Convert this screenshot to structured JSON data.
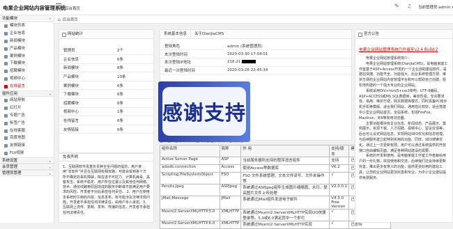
{
  "header": {
    "brand": "电果企业网站内容管理系统",
    "site_home": "后台首页",
    "user": "当前管理员:admin"
  },
  "sidebar": [
    {
      "section": "功能模块",
      "items": [
        {
          "label": "模块列表"
        },
        {
          "label": "企业信息"
        },
        {
          "label": "新闻模块"
        },
        {
          "label": "产品模块"
        },
        {
          "label": "案例模块"
        },
        {
          "label": "下载模块"
        },
        {
          "label": "招聘模块"
        },
        {
          "label": "视频中心"
        },
        {
          "label": "在线留言",
          "active": true
        }
      ]
    },
    {
      "section": "插件应用",
      "items": [
        {
          "label": "网站导航"
        },
        {
          "label": "幻灯片"
        },
        {
          "label": "专题广告"
        },
        {
          "label": "标签广告"
        },
        {
          "label": "在线客服"
        },
        {
          "label": "百度地图"
        },
        {
          "label": "友情链接"
        },
        {
          "label": "FLV视频"
        }
      ]
    },
    {
      "section": "系统设置",
      "items": []
    },
    {
      "section": "会员管理",
      "items": []
    },
    {
      "section": "管理员管理",
      "items": []
    }
  ],
  "tabbar": {
    "home": "后台首页"
  },
  "stats": {
    "title": "网站统计",
    "rows": [
      {
        "label": "管理员",
        "value": "2个"
      },
      {
        "label": "企业信息",
        "value": "6条"
      },
      {
        "label": "新闻模块",
        "value": "8条"
      },
      {
        "label": "产品模块",
        "value": "10条"
      },
      {
        "label": "案例模块",
        "value": "6条"
      },
      {
        "label": "下载模块",
        "value": "6条"
      },
      {
        "label": "招聘模块",
        "value": "6条"
      },
      {
        "label": "视频中心",
        "value": "1条"
      },
      {
        "label": "在线留言",
        "value": "6条"
      },
      {
        "label": "友情链接",
        "value": "6条"
      }
    ]
  },
  "sysinfo": {
    "tabs": [
      "系统基本信息",
      "关于DianJiaCMS"
    ],
    "rows": [
      {
        "label": "登陆角色",
        "value": "admin (系统管理员)"
      },
      {
        "label": "本次登陆时间",
        "value": "2020-03-30 17:04:01"
      },
      {
        "label": "本次登陆IP地址",
        "value": "218.21."
      },
      {
        "label": "最近一次登陆时间",
        "value": "2020-03-26 22:45:34"
      }
    ]
  },
  "overlay": {
    "text": "感谢支持"
  },
  "components": {
    "title": "基本组件检测（如果下面几项都显示会同时进行预览）",
    "headers": [
      "组件名称",
      "简称",
      "作 用",
      "支持/版本",
      "建议"
    ],
    "rows": [
      {
        "name": "Active Server Page",
        "short": "ASP",
        "use": "当前服务器所支持的程序语言组件",
        "ver": "支持",
        "advice": "已支持"
      },
      {
        "name": "adodb.connection",
        "short": "Access",
        "use": "使用Access等数据库",
        "ver": "V6.2",
        "advice": "已支持"
      },
      {
        "name": "Scripting.FileSystemObject",
        "short": "FSO",
        "use": "FSO 文件系统管理、文本文件读写、文件夹操作等",
        "ver": "√",
        "advice": "已支持"
      },
      {
        "name": "Persits.Jpeg",
        "short": "ASPJpeg",
        "use": "系统通过ASPJpeg组件生成图片缩略图，水印，提高图片文件上传处理",
        "ver": "V2.0.0.1",
        "advice": "已支持"
      },
      {
        "name": "JMail.Message",
        "short": "JMail",
        "use": "系统通过JMail组件发送电子邮件",
        "ver": "V4.3.0 Free Version",
        "advice": "已支持"
      },
      {
        "name": "Msxml2.ServerXMLHTTP.5.0",
        "short": "XMLHTTP",
        "use": "系统通过Msxml2.ServerXMLHTTP实现QQ快捷登录等。5.0或6.0满足其中一个即可",
        "ver": "√",
        "advice": "已支持"
      },
      {
        "name": "Msxml2.ServerXMLHTTP.6.0",
        "short": "XMLHTTP",
        "use": "系统通过Msxml2.ServerXMLHTTP实现",
        "ver": "√",
        "advice": "已支持"
      }
    ]
  },
  "disclaimer": {
    "title": "免责声明",
    "body": "1、互联网软件看重负责种全全问题的提前，用户使用“本软件”并且在互联网有相安路，可能会受到各个方所不确定的事机障碍，除在进不可抗力、计算机病毒、黑客攻击、系统不稳定、用户所在位置以及其他任何网络、技术、通信线路等原因造成的服务中断或不能满足用户要求的风险，开发者不对此承担任何责任。 2、用户在使用本系统时引用的内容、信息发布，有可能涉及法律法规问题，开发者不承担任何法律责任，由用户本人承担。3、互联网上流传、复制、发布、传播的信息，开发者不承担任何法律责任。"
  },
  "notice": {
    "title": "官方公告",
    "link": "电果企业网站管理系统已升级至v2.4 Build 2",
    "paragraphs": [
      "电果企业网站管理系统简介：",
      "电果企业网站管理系统(DianJiaCMS)，是电脑家庭工作室基于ASP+Access开发的一个企业自助建站软件，是建站快捷、功能齐全、功能强大、后台系统管理方便、维护方便的企业网站内容管理平台和可以帮助自己创建、轻松地构建的一个强大专业的企业网站。",
      "系统采用DIV+html5+css3架构，UTF-8编码，ASP+ACCESS或MS SQL数据库，兼容性强，空间要求低，易用、维护方便，网页数据库模式，同时具备PC和手机手机等模版。适合我们网站，通用性比较好，适合搭建中小型企业网站首页。全站系统，包括FireFox、Maxthon、IE8等常用浏览器。",
      "主要功能模块有企业信息、新闻动态、产品展示、案例展示、资源下载、人才招聘、视频中心、留言反馈等，后台可以设定网站信息，实现网站SEO优化和信息管理，与后续服务建立起特别实用的功能。同样，SEO搜索优化、通过上一次更新有限。用户可以通过系统提供的开放接口自由编辑页面，满足各种网站建设的需要。",
      "系统的开发和使用，是电脑家庭工作室工作者献给用户的一份礼物，欢迎使用和交流，后续我们还会持续更新完善，推出更多有意义的功能，提供更多好用的建站工具，让您的企业网站更加完善和专业，为中小企业建站提供免费服务。"
    ]
  }
}
